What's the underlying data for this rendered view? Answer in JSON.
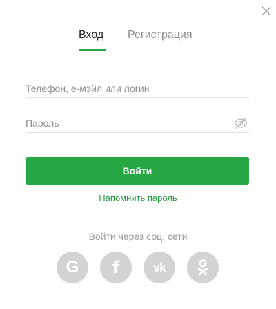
{
  "dialog": {
    "close_icon": "close-icon"
  },
  "tabs": {
    "login_label": "Вход",
    "register_label": "Регистрация",
    "active_color": "#27a744"
  },
  "form": {
    "login_placeholder": "Телефон, е-мэйл или логин",
    "login_value": "",
    "password_placeholder": "Пароль",
    "password_value": "",
    "password_toggle_icon": "eye-slash-icon",
    "submit_label": "Войти",
    "forgot_label": "Напомнить пароль"
  },
  "social": {
    "label": "Войти через соц. сети",
    "providers": [
      {
        "name": "google",
        "glyph": "G",
        "icon": "google-icon"
      },
      {
        "name": "facebook",
        "glyph": "f",
        "icon": "facebook-icon"
      },
      {
        "name": "vk",
        "glyph": "vk",
        "icon": "vk-icon"
      },
      {
        "name": "odnoklassniki",
        "icon": "odnoklassniki-icon"
      }
    ]
  },
  "colors": {
    "brand_green": "#27a744",
    "link_green": "#1e9a3c",
    "social_gray": "#d3d3d3",
    "muted_text": "#8f8f8f"
  }
}
